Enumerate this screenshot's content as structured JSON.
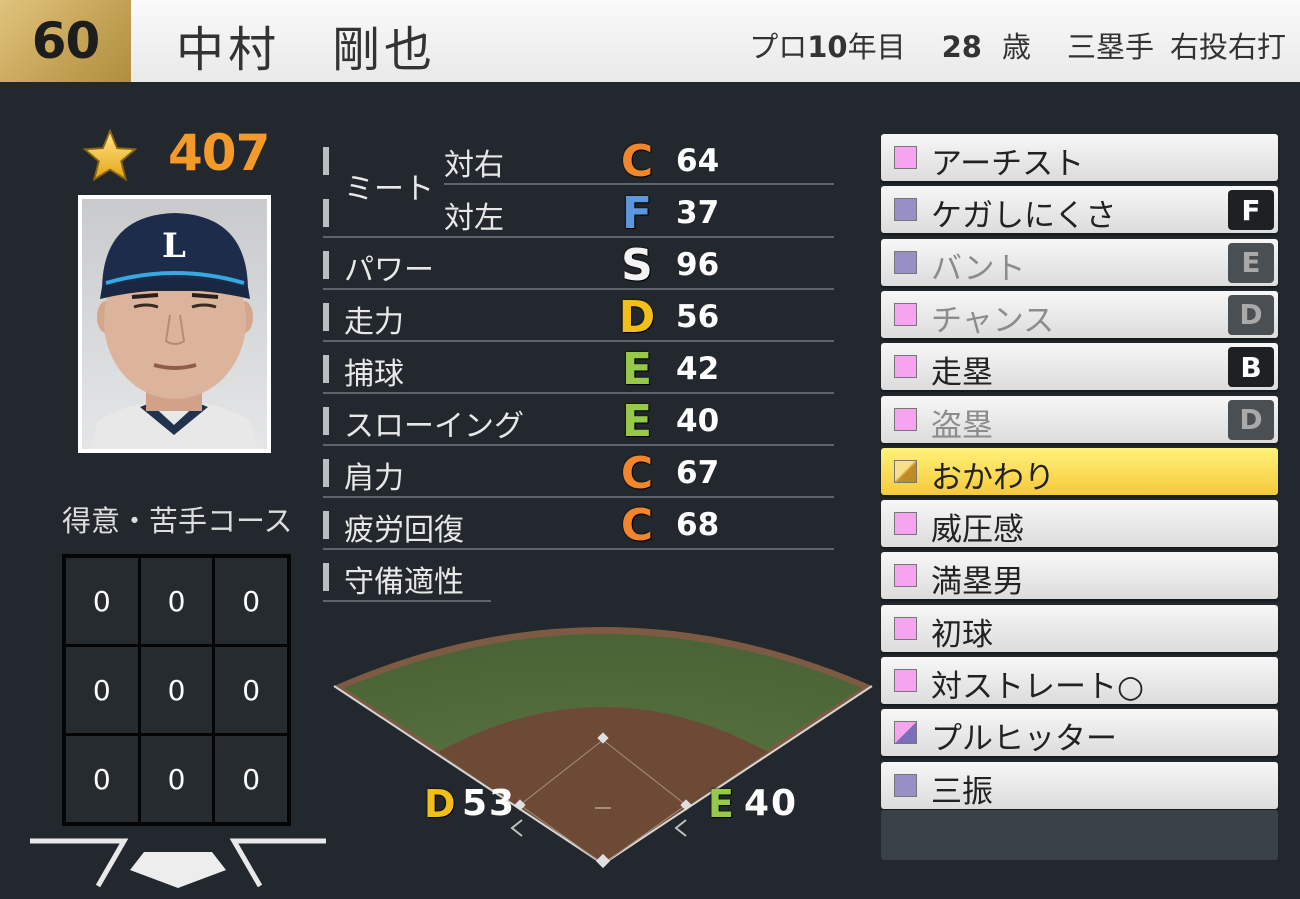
{
  "player": {
    "number": "60",
    "name": "中村　剛也",
    "pro_label": "プロ",
    "pro_years": "10",
    "pro_suffix": "年目",
    "age": "28",
    "age_suffix": "歳",
    "position": "三塁手",
    "handedness": "右投右打",
    "overall": "407"
  },
  "icons": {
    "star": "star-icon",
    "portrait": "player-portrait",
    "home_plate": "home-plate-icon"
  },
  "course": {
    "title": "得意・苦手コース",
    "cells": [
      "0",
      "0",
      "0",
      "0",
      "0",
      "0",
      "0",
      "0",
      "0"
    ]
  },
  "stats": {
    "meet_label": "ミート",
    "meet_vs_right": {
      "label": "対右",
      "rank": "C",
      "value": "64"
    },
    "meet_vs_left": {
      "label": "対左",
      "rank": "F",
      "value": "37"
    },
    "rows": [
      {
        "label": "パワー",
        "rank": "S",
        "value": "96"
      },
      {
        "label": "走力",
        "rank": "D",
        "value": "56"
      },
      {
        "label": "捕球",
        "rank": "E",
        "value": "42"
      },
      {
        "label": "スローイング",
        "rank": "E",
        "value": "40"
      },
      {
        "label": "肩力",
        "rank": "C",
        "value": "67"
      },
      {
        "label": "疲労回復",
        "rank": "C",
        "value": "68"
      }
    ],
    "fielding_label": "守備適性"
  },
  "rank_colors": {
    "S": "#f3f3f3",
    "B": "#e64848",
    "C": "#f2862c",
    "D": "#f2bf19",
    "E": "#96c94a",
    "F": "#5d97dc"
  },
  "field": {
    "left_rank": "D",
    "left_value": "53",
    "right_rank": "E",
    "right_value": "40",
    "grass_color": "#526d3c",
    "dirt_color": "#6d4a36"
  },
  "abilities": [
    {
      "label": "アーチスト",
      "icon": "pink-square",
      "icon_color": "#f7a4f0",
      "grade": "",
      "dim": false,
      "highlight": false
    },
    {
      "label": "ケガしにくさ",
      "icon": "purple-square",
      "icon_color": "#9890c4",
      "grade": "F",
      "dim": false,
      "highlight": false
    },
    {
      "label": "バント",
      "icon": "purple-square",
      "icon_color": "#9890c4",
      "grade": "E",
      "dim": true,
      "highlight": false
    },
    {
      "label": "チャンス",
      "icon": "pink-square",
      "icon_color": "#f7a4f0",
      "grade": "D",
      "dim": true,
      "highlight": false
    },
    {
      "label": "走塁",
      "icon": "pink-square",
      "icon_color": "#f7a4f0",
      "grade": "B",
      "dim": false,
      "highlight": false
    },
    {
      "label": "盗塁",
      "icon": "pink-square",
      "icon_color": "#f7a4f0",
      "grade": "D",
      "dim": true,
      "highlight": false
    },
    {
      "label": "おかわり",
      "icon": "gold-square",
      "icon_color": "#d4a23a",
      "grade": "",
      "dim": false,
      "highlight": true
    },
    {
      "label": "威圧感",
      "icon": "pink-square",
      "icon_color": "#f7a4f0",
      "grade": "",
      "dim": false,
      "highlight": false
    },
    {
      "label": "満塁男",
      "icon": "pink-square",
      "icon_color": "#f7a4f0",
      "grade": "",
      "dim": false,
      "highlight": false
    },
    {
      "label": "初球",
      "icon": "pink-square",
      "icon_color": "#f7a4f0",
      "grade": "",
      "dim": false,
      "highlight": false
    },
    {
      "label": "対ストレート○",
      "icon": "pink-square",
      "icon_color": "#f7a4f0",
      "grade": "",
      "dim": false,
      "highlight": false
    },
    {
      "label": "プルヒッター",
      "icon": "split-square",
      "icon_color": "#b58ad0",
      "grade": "",
      "dim": false,
      "highlight": false
    },
    {
      "label": "三振",
      "icon": "purple-square",
      "icon_color": "#9890c4",
      "grade": "",
      "dim": false,
      "highlight": false
    }
  ]
}
